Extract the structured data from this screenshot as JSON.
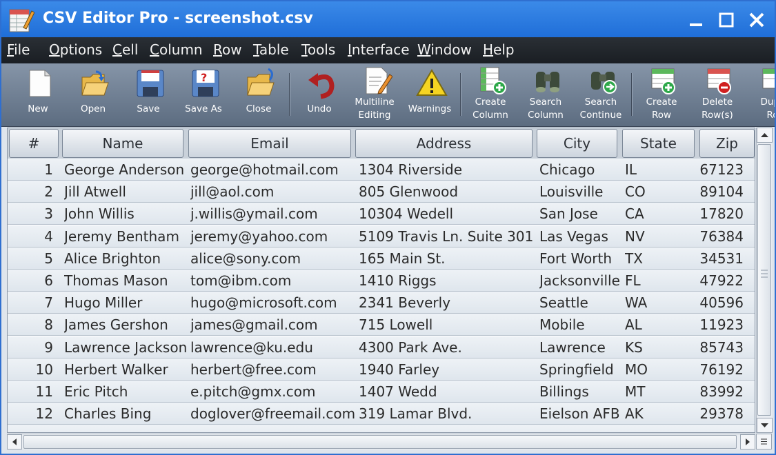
{
  "window": {
    "title": "CSV Editor Pro - screenshot.csv",
    "accent_color": "#2f6fd0"
  },
  "menu": [
    {
      "label": "File",
      "underline": "F",
      "rest": "ile"
    },
    {
      "label": "Options",
      "underline": "O",
      "rest": "ptions"
    },
    {
      "label": "Cell",
      "underline": "C",
      "rest": "ell"
    },
    {
      "label": "Column",
      "underline": "C",
      "rest": "olumn"
    },
    {
      "label": "Row",
      "underline": "R",
      "rest": "ow"
    },
    {
      "label": "Table",
      "underline": "T",
      "rest": "able"
    },
    {
      "label": "Tools",
      "underline": "T",
      "rest": "ools"
    },
    {
      "label": "Interface",
      "underline": "I",
      "rest": "nterface"
    },
    {
      "label": "Window",
      "underline": "W",
      "rest": "indow"
    },
    {
      "label": "Help",
      "underline": "H",
      "rest": "elp"
    }
  ],
  "toolbar": [
    {
      "label": "New",
      "icon": "new-file-icon"
    },
    {
      "label": "Open",
      "icon": "open-folder-icon"
    },
    {
      "label": "Save",
      "icon": "save-disk-icon"
    },
    {
      "label": "Save As",
      "icon": "save-as-icon"
    },
    {
      "label": "Close",
      "icon": "close-folder-icon"
    },
    {
      "label": "Undo",
      "icon": "undo-icon"
    },
    {
      "label": "Multiline\nEditing",
      "icon": "multiline-edit-icon"
    },
    {
      "label": "Warnings",
      "icon": "warning-icon"
    },
    {
      "label": "Create\nColumn",
      "icon": "create-column-icon"
    },
    {
      "label": "Search\nColumn",
      "icon": "search-column-icon"
    },
    {
      "label": "Search\nContinue",
      "icon": "search-continue-icon"
    },
    {
      "label": "Create\nRow",
      "icon": "create-row-icon"
    },
    {
      "label": "Delete\nRow(s)",
      "icon": "delete-row-icon"
    },
    {
      "label": "Dupli\nRo",
      "icon": "duplicate-row-icon"
    }
  ],
  "table": {
    "columns": [
      "#",
      "Name",
      "Email",
      "Address",
      "City",
      "State",
      "Zip"
    ],
    "rows": [
      [
        "1",
        "George Anderson",
        "george@hotmail.com",
        "1304 Riverside",
        "Chicago",
        "IL",
        "67123"
      ],
      [
        "2",
        "Jill Atwell",
        "jill@aol.com",
        "805 Glenwood",
        "Louisville",
        "CO",
        "89104"
      ],
      [
        "3",
        "John Willis",
        "j.willis@ymail.com",
        "10304 Wedell",
        "San Jose",
        "CA",
        "17820"
      ],
      [
        "4",
        "Jeremy Bentham",
        "jeremy@yahoo.com",
        "5109 Travis Ln. Suite 301",
        "Las Vegas",
        "NV",
        "76384"
      ],
      [
        "5",
        "Alice Brighton",
        "alice@sony.com",
        "165 Main St.",
        "Fort Worth",
        "TX",
        "34531"
      ],
      [
        "6",
        "Thomas Mason",
        "tom@ibm.com",
        "1410 Riggs",
        "Jacksonville",
        "FL",
        "47922"
      ],
      [
        "7",
        "Hugo Miller",
        "hugo@microsoft.com",
        "2341 Beverly",
        "Seattle",
        "WA",
        "40596"
      ],
      [
        "8",
        "James Gershon",
        "james@gmail.com",
        "715 Lowell",
        "Mobile",
        "AL",
        "11923"
      ],
      [
        "9",
        "Lawrence Jackson",
        "lawrence@ku.edu",
        "4300 Park Ave.",
        "Lawrence",
        "KS",
        "85743"
      ],
      [
        "10",
        "Herbert Walker",
        "herbert@free.com",
        "1940 Farley",
        "Springfield",
        "MO",
        "76192"
      ],
      [
        "11",
        "Eric Pitch",
        "e.pitch@gmx.com",
        "1407 Wedd",
        "Billings",
        "MT",
        "83992"
      ],
      [
        "12",
        "Charles Bing",
        "doglover@freemail.com",
        "319 Lamar Blvd.",
        "Eielson AFB",
        "AK",
        "29378"
      ]
    ]
  }
}
